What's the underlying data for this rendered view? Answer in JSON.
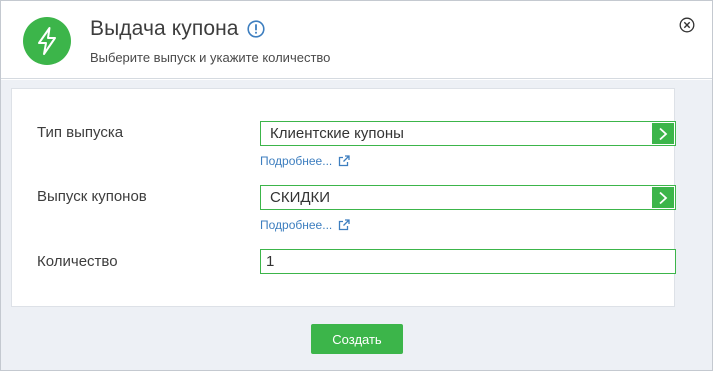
{
  "dialog": {
    "title": "Выдача купона",
    "subtitle": "Выберите выпуск и укажите количество"
  },
  "form": {
    "release_type": {
      "label": "Тип выпуска",
      "value": "Клиентские купоны",
      "more_link": "Подробнее..."
    },
    "coupon_release": {
      "label": "Выпуск купонов",
      "value": "СКИДКИ",
      "more_link": "Подробнее..."
    },
    "quantity": {
      "label": "Количество",
      "value": "1"
    }
  },
  "actions": {
    "create_label": "Создать"
  },
  "icons": {
    "header": "lightning-icon",
    "info": "info-icon",
    "close": "close-icon",
    "select": "chevron-right-icon",
    "external": "external-link-icon"
  },
  "colors": {
    "accent": "#3cb54a",
    "link": "#3d7ebf",
    "body_bg": "#edf0f5"
  }
}
